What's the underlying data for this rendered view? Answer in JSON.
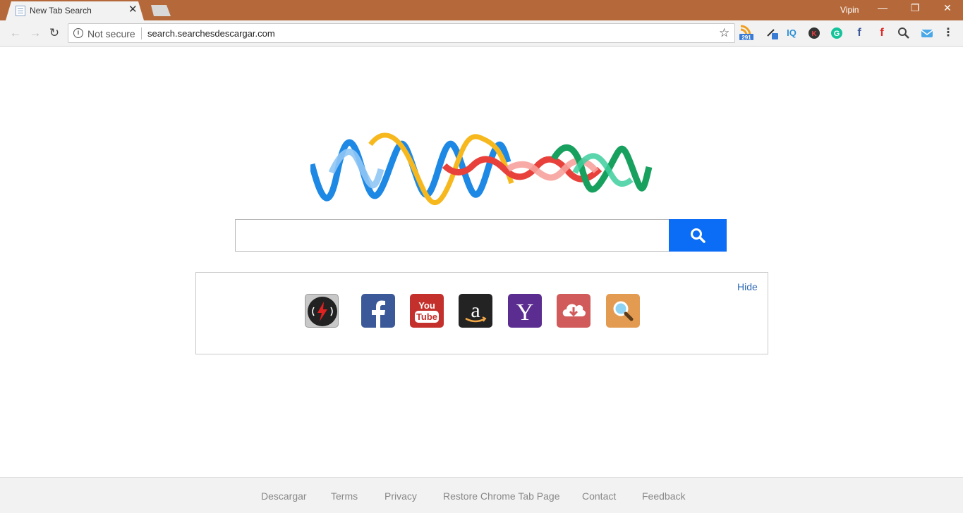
{
  "browser": {
    "tab_title": "New Tab Search",
    "tab_close": "✕",
    "username": "Vipin",
    "window_controls": {
      "minimize": "—",
      "restore": "❐",
      "close": "✕"
    },
    "nav": {
      "back": "←",
      "forward": "→",
      "reload": "↻"
    },
    "omnibox": {
      "security_label": "Not secure",
      "url": "search.searchesdescargar.com",
      "star": "☆"
    },
    "extensions": [
      "rss-icon",
      "eyedropper-icon",
      "iq-icon",
      "k-icon",
      "grammarly-icon",
      "facebook-icon",
      "flipboard-f-icon",
      "search-icon",
      "mail-icon"
    ],
    "extension_badge": "291",
    "menu": "⋮"
  },
  "main": {
    "search": {
      "placeholder": ""
    },
    "shortcuts": {
      "hide_label": "Hide",
      "tiles": [
        {
          "name": "radio-icon",
          "bg": "#c8c8c8"
        },
        {
          "name": "facebook-icon",
          "bg": "#3b5998"
        },
        {
          "name": "youtube-icon",
          "bg": "#c4302b"
        },
        {
          "name": "amazon-icon",
          "bg": "#232323"
        },
        {
          "name": "yahoo-icon",
          "bg": "#5c2d91"
        },
        {
          "name": "download-icon",
          "bg": "#d15a5a"
        },
        {
          "name": "search-icon",
          "bg": "#e39b52"
        }
      ]
    }
  },
  "footer": {
    "links": [
      "Descargar",
      "Terms",
      "Privacy",
      "Restore Chrome Tab Page",
      "Contact",
      "Feedback"
    ]
  },
  "colors": {
    "titlebar": "#b5693a",
    "search_button": "#0b6cf5",
    "logo_blue": "#1e88e5",
    "logo_yellow": "#f6b81c",
    "logo_red": "#e8403a",
    "logo_green": "#18a05e"
  }
}
